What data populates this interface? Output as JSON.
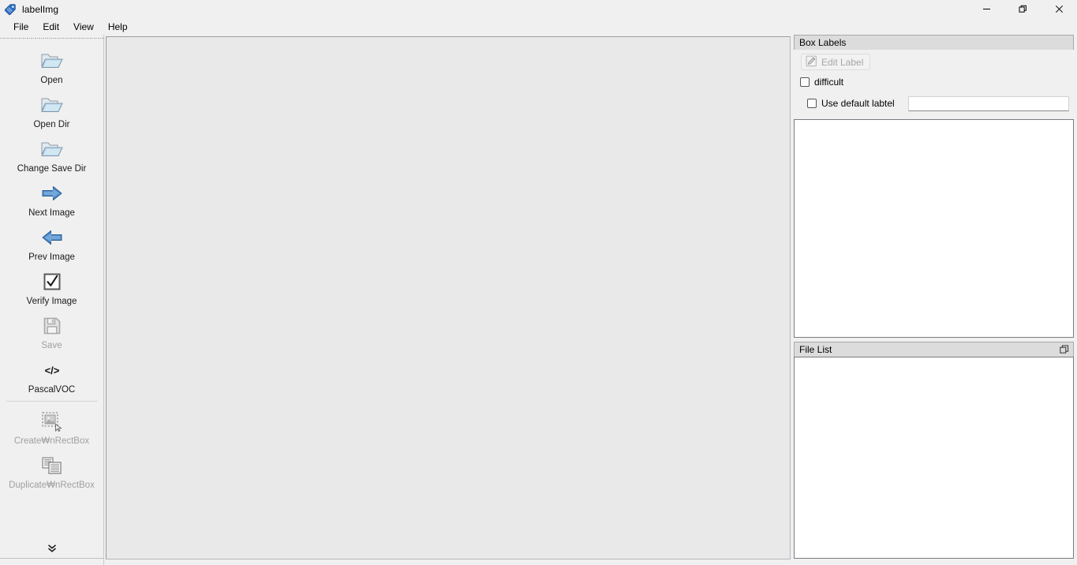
{
  "window": {
    "title": "labelImg",
    "icon": "tag-icon",
    "controls": [
      {
        "name": "minimize",
        "glyph": "—"
      },
      {
        "name": "restore",
        "glyph": "❐"
      },
      {
        "name": "close",
        "glyph": "✕"
      }
    ]
  },
  "menubar": {
    "items": [
      {
        "label": "File"
      },
      {
        "label": "Edit"
      },
      {
        "label": "View"
      },
      {
        "label": "Help"
      }
    ]
  },
  "toolbar": {
    "items": [
      {
        "label": "Open",
        "icon": "folder-open-icon",
        "disabled": false,
        "separator_after": false
      },
      {
        "label": "Open Dir",
        "icon": "folder-open-icon",
        "disabled": false,
        "separator_after": false
      },
      {
        "label": "Change Save Dir",
        "icon": "folder-open-icon",
        "disabled": false,
        "separator_after": false
      },
      {
        "label": "Next Image",
        "icon": "arrow-right-icon",
        "disabled": false,
        "separator_after": false
      },
      {
        "label": "Prev Image",
        "icon": "arrow-left-icon",
        "disabled": false,
        "separator_after": false
      },
      {
        "label": "Verify Image",
        "icon": "checkbox-check-icon",
        "disabled": false,
        "separator_after": false
      },
      {
        "label": "Save",
        "icon": "floppy-disk-icon",
        "disabled": true,
        "separator_after": false
      },
      {
        "label": "PascalVOC",
        "icon": "code-tags-icon",
        "disabled": false,
        "separator_after": true
      },
      {
        "label": "Create₩nRectBox",
        "icon": "create-rect-icon",
        "disabled": true,
        "separator_after": false
      },
      {
        "label": "Duplicate₩nRectBox",
        "icon": "duplicate-rect-icon",
        "disabled": true,
        "separator_after": false
      }
    ],
    "more_glyph": "ˇˇ"
  },
  "box_labels": {
    "title": "Box Labels",
    "edit_label_button": "Edit Label",
    "edit_label_icon": "pencil-edit-icon",
    "difficult_checkbox": "difficult",
    "difficult_checked": false,
    "use_default_checkbox": "Use default labtel",
    "use_default_checked": false,
    "default_label_value": "",
    "default_label_placeholder": ""
  },
  "file_list": {
    "title": "File List",
    "float_icon": "float-window-icon",
    "items": []
  },
  "colors": {
    "window_bg": "#f0f0f0",
    "canvas_bg": "#e9e9e9",
    "dock_header_bg": "#dcdcdc",
    "accent_blue": "#4a86c8",
    "disabled_text": "#a0a0a0"
  }
}
